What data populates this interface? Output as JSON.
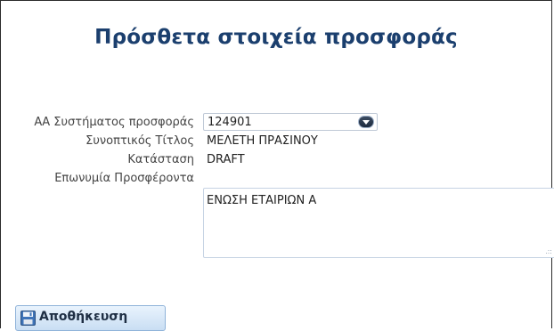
{
  "form": {
    "title": "Πρόσθετα στοιχεία προσφοράς",
    "fields": {
      "offer_system_id": {
        "label": "ΑΑ Συστήματος προσφοράς",
        "value": "124901"
      },
      "short_title": {
        "label": "Συνοπτικός Τίτλος",
        "value": "ΜΕΛΕΤΗ ΠΡΑΣΙΝΟΥ"
      },
      "status": {
        "label": "Κατάσταση",
        "value": "DRAFT"
      },
      "bidder_name": {
        "label": "Επωνυμία Προσφέροντα",
        "value": "ΕΝΩΣΗ ΕΤΑΙΡΙΩΝ Α"
      }
    },
    "save_button": {
      "label": "Αποθήκευση",
      "icon": "floppy-disk-icon"
    }
  }
}
